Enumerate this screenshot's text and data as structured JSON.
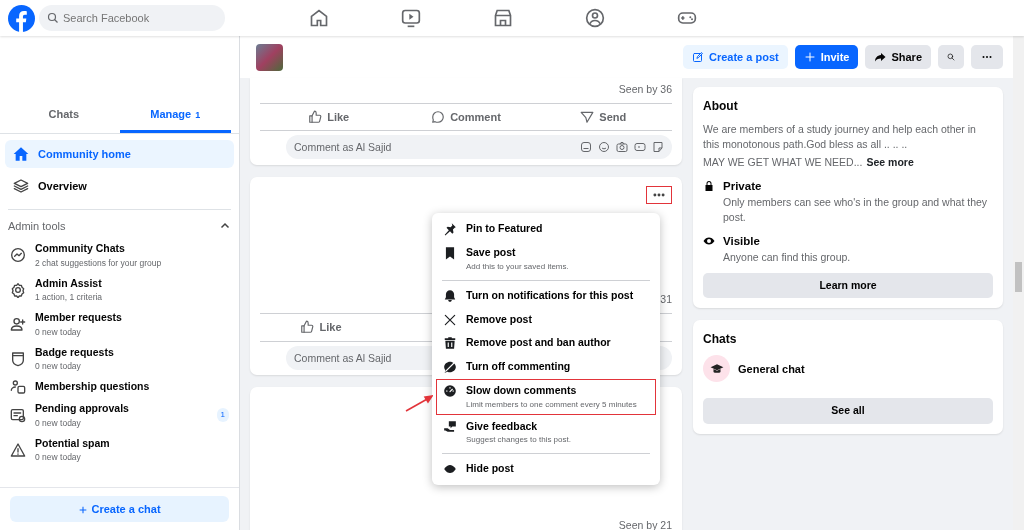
{
  "top_bar": {
    "search": {
      "placeholder": "Search Facebook"
    }
  },
  "sidebar": {
    "tabs": [
      {
        "label": "Chats",
        "selected": false
      },
      {
        "label": "Manage",
        "count": "1",
        "selected": true
      }
    ],
    "nav_items": [
      {
        "kind": "home",
        "label": "Community home",
        "selected": true
      },
      {
        "kind": "layers",
        "label": "Overview",
        "selected": false
      }
    ],
    "admin_tools": {
      "title": "Admin tools",
      "expanded": true,
      "items": [
        {
          "kind": "chat",
          "label": "Community Chats",
          "subtitle": "2 chat suggestions for your group"
        },
        {
          "kind": "gear",
          "label": "Admin Assist",
          "subtitle": "1 action, 1 criteria"
        },
        {
          "kind": "person-add",
          "label": "Member requests",
          "subtitle": "0 new today"
        },
        {
          "kind": "shield",
          "label": "Badge requests",
          "subtitle": "0 new today"
        },
        {
          "kind": "questions",
          "label": "Membership questions"
        },
        {
          "kind": "approvals",
          "label": "Pending approvals",
          "subtitle": "0 new today",
          "badge": "1"
        },
        {
          "kind": "warning",
          "label": "Potential spam",
          "subtitle": "0 new today"
        }
      ]
    },
    "create_button": "Create a chat"
  },
  "group_header": {
    "buttons": [
      {
        "kind": "create",
        "label": "Create a post"
      },
      {
        "kind": "invite",
        "label": "Invite"
      },
      {
        "kind": "share",
        "label": "Share"
      },
      {
        "kind": "search"
      },
      {
        "kind": "more"
      }
    ]
  },
  "posts": [
    {
      "seen": "Seen by 36",
      "actions": [
        {
          "kind": "like",
          "label": "Like"
        },
        {
          "kind": "comment",
          "label": "Comment"
        },
        {
          "kind": "send",
          "label": "Send"
        }
      ],
      "comment_placeholder": "Comment as Al Sajid"
    },
    {
      "more_highlighted": true,
      "seen": "31",
      "actions": [
        {
          "kind": "like",
          "label": "Like"
        }
      ],
      "comment_placeholder": "Comment as Al Sajid"
    },
    {
      "seen": "Seen by 21"
    }
  ],
  "post_menu": {
    "items": [
      {
        "kind": "pin",
        "label": "Pin to Featured",
        "highlighted": false
      },
      {
        "kind": "bookmark",
        "label": "Save post",
        "subtitle": "Add this to your saved items.",
        "highlighted": false
      },
      {
        "kind": "divider"
      },
      {
        "kind": "bell",
        "label": "Turn on notifications for this post",
        "highlighted": false
      },
      {
        "kind": "cross",
        "label": "Remove post",
        "highlighted": false
      },
      {
        "kind": "trash",
        "label": "Remove post and ban author",
        "highlighted": false
      },
      {
        "kind": "comment-off",
        "label": "Turn off commenting",
        "highlighted": false
      },
      {
        "kind": "gauge",
        "label": "Slow down comments",
        "subtitle": "Limit members to one comment every 5 minutes",
        "highlighted": true
      },
      {
        "kind": "feedback",
        "label": "Give feedback",
        "subtitle": "Suggest changes to this post.",
        "highlighted": false
      },
      {
        "kind": "divider"
      },
      {
        "kind": "hide",
        "label": "Hide post",
        "highlighted": false
      }
    ]
  },
  "about": {
    "title": "About",
    "description": "We are members of a study journey and help each other in this monotonous path.God bless as all .. .. ..",
    "tagline": "MAY WE GET WHAT WE NEED...",
    "see_more": "See more",
    "settings": [
      {
        "kind": "lock",
        "title": "Private",
        "text": "Only members can see who's in the group and what they post."
      },
      {
        "kind": "eye",
        "title": "Visible",
        "text": "Anyone can find this group."
      }
    ],
    "button": "Learn more"
  },
  "chats": {
    "title": "Chats",
    "items": [
      {
        "name": "General chat"
      }
    ],
    "button": "See all"
  }
}
